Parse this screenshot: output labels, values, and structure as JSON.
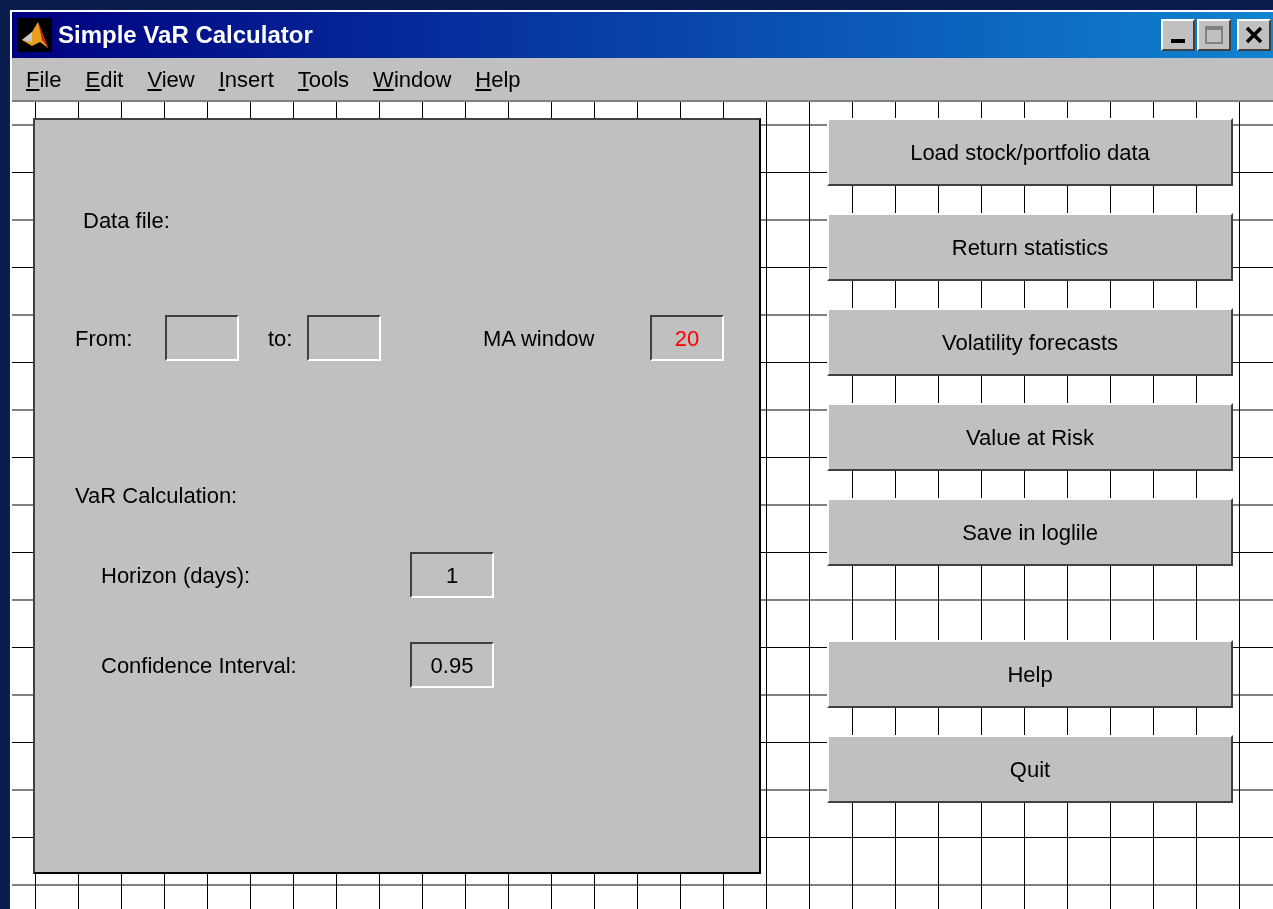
{
  "window": {
    "title": "Simple VaR Calculator"
  },
  "menu": [
    {
      "label": "File"
    },
    {
      "label": "Edit"
    },
    {
      "label": "View"
    },
    {
      "label": "Insert"
    },
    {
      "label": "Tools"
    },
    {
      "label": "Window"
    },
    {
      "label": "Help"
    }
  ],
  "panel": {
    "data_file_label": "Data file:",
    "from": {
      "label": "From:"
    },
    "to": {
      "label": "to:"
    },
    "ma_window": {
      "label": "MA window",
      "value": "20",
      "color": "#ff0000"
    },
    "section_label": "VaR Calculation:",
    "horizon": {
      "label": "Horizon (days):",
      "value": "1"
    },
    "confidence": {
      "label": "Confidence Interval:",
      "value": "0.95"
    }
  },
  "buttons": [
    {
      "label": "Load stock/portfolio data"
    },
    {
      "label": "Return statistics"
    },
    {
      "label": "Volatility forecasts"
    },
    {
      "label": "Value at Risk"
    },
    {
      "label": "Save in loglile"
    },
    {
      "label": "Help",
      "gap": true
    },
    {
      "label": "Quit"
    }
  ]
}
